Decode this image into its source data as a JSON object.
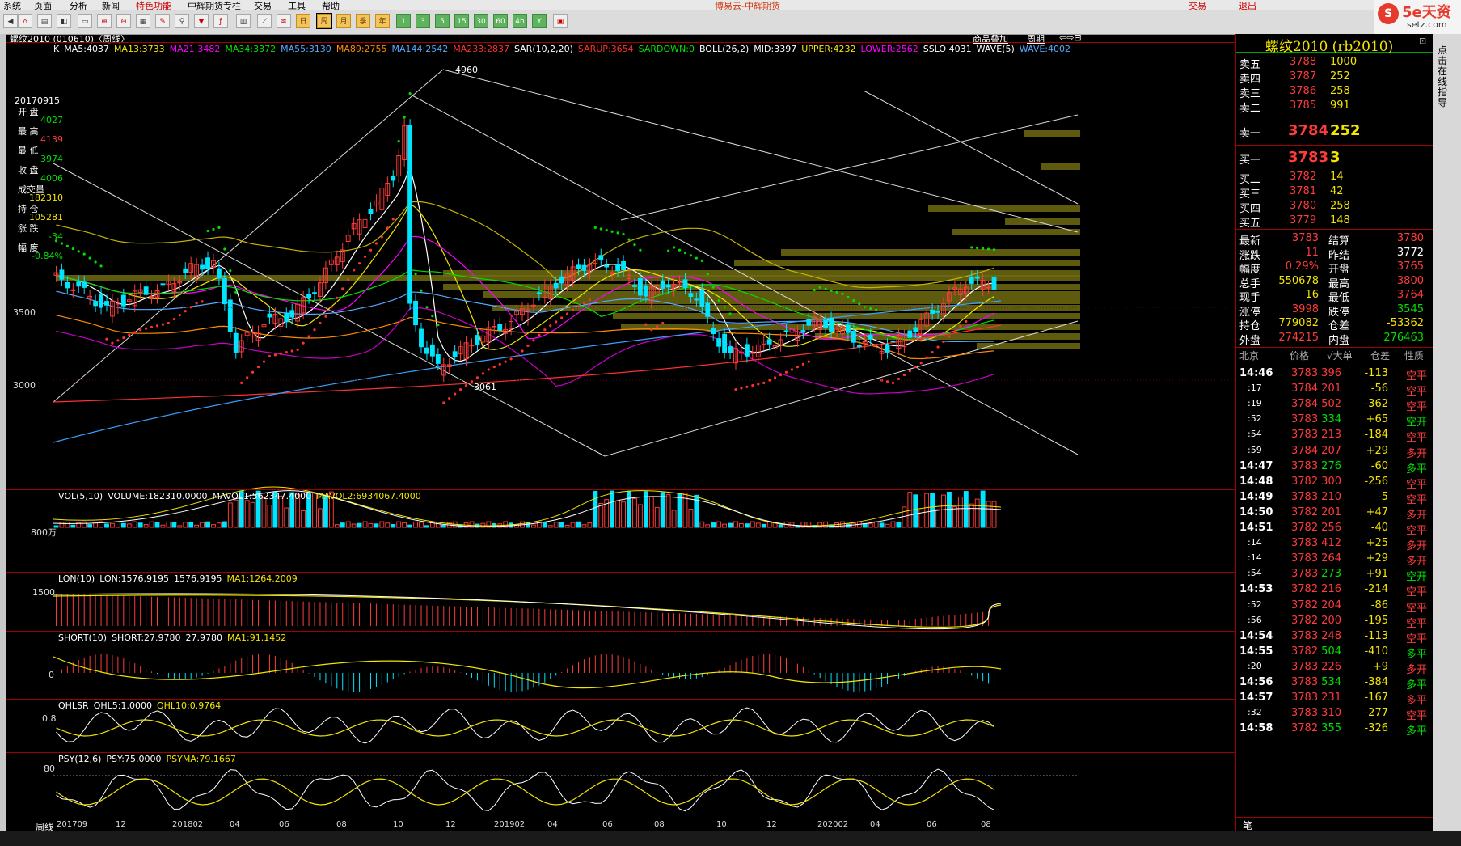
{
  "menu": {
    "items": [
      "系统",
      "页面",
      "分析",
      "新闻",
      "特色功能",
      "中辉期货专栏",
      "交易",
      "工具",
      "帮助"
    ],
    "title": "博易云-中辉期货",
    "trade_label": "交易",
    "exit_label": "退出"
  },
  "toolbar": {
    "period_buttons": [
      "日",
      "周",
      "月",
      "季",
      "年"
    ],
    "number_buttons": [
      "1",
      "3",
      "5",
      "15",
      "30",
      "60",
      "4h",
      "Y"
    ]
  },
  "chart": {
    "symbol_label": "螺纹2010 (010610)〈周线〉",
    "ma_header": [
      {
        "text": "K",
        "color": "#ffffff"
      },
      {
        "text": "MA5:4037",
        "color": "#ffffff"
      },
      {
        "text": "MA13:3733",
        "color": "#f2e500"
      },
      {
        "text": "MA21:3482",
        "color": "#ff00ff"
      },
      {
        "text": "MA34:3372",
        "color": "#00e000"
      },
      {
        "text": "MA55:3130",
        "color": "#55aaff"
      },
      {
        "text": "MA89:2755",
        "color": "#ff8c00"
      },
      {
        "text": "MA144:2542",
        "color": "#55aaff"
      },
      {
        "text": "MA233:2837",
        "color": "#ff3030"
      },
      {
        "text": "SAR(10,2,20)",
        "color": "#ffffff"
      },
      {
        "text": "SARUP:3654",
        "color": "#ff3030"
      },
      {
        "text": "SARDOWN:0",
        "color": "#00e000"
      },
      {
        "text": "BOLL(26,2)",
        "color": "#ffffff"
      },
      {
        "text": "MID:3397",
        "color": "#ffffff"
      },
      {
        "text": "UPPER:4232",
        "color": "#f2e500"
      },
      {
        "text": "LOWER:2562",
        "color": "#ff00ff"
      },
      {
        "text": "SSLO 4031",
        "color": "#ffffff"
      },
      {
        "text": "WAVE(5)",
        "color": "#ffffff"
      },
      {
        "text": "WAVE:4002",
        "color": "#55aaff"
      }
    ],
    "top_right_links": [
      "商品叠加",
      "周期"
    ],
    "price_axis": [
      "3500",
      "3000"
    ],
    "high_label": "4960",
    "low_label": "3061",
    "info_panel": {
      "date": "20170915",
      "open_label": "开 盘",
      "open": "4027",
      "high_label": "最 高",
      "high": "4139",
      "low_label": "最 低",
      "low": "3974",
      "close_label": "收 盘",
      "close": "4006",
      "vol_label": "成交量",
      "vol": "182310",
      "oi_label": "持 仓",
      "oi": "105281",
      "chg_label": "涨 跌",
      "chg": "-34",
      "pct_label": "幅 度",
      "pct": "-0.84%"
    },
    "vol_header": [
      {
        "text": "VOL(5,10)",
        "color": "#ffffff"
      },
      {
        "text": "VOLUME:182310.0000",
        "color": "#ffffff"
      },
      {
        "text": "MAVOL1:562347.4000",
        "color": "#ffffff"
      },
      {
        "text": "MAVOL2:6934067.4000",
        "color": "#f2e500"
      }
    ],
    "vol_axis": "800万",
    "lon_header": [
      {
        "text": "LON(10)",
        "color": "#ffffff"
      },
      {
        "text": "LON:1576.9195",
        "color": "#ffffff"
      },
      {
        "text": "1576.9195",
        "color": "#ffffff"
      },
      {
        "text": "MA1:1264.2009",
        "color": "#f2e500"
      }
    ],
    "lon_axis": "1500",
    "short_header": [
      {
        "text": "SHORT(10)",
        "color": "#ffffff"
      },
      {
        "text": "SHORT:27.9780",
        "color": "#ffffff"
      },
      {
        "text": "27.9780",
        "color": "#ffffff"
      },
      {
        "text": "MA1:91.1452",
        "color": "#f2e500"
      }
    ],
    "short_axis": "0",
    "qhl_header": [
      {
        "text": "QHLSR",
        "color": "#ffffff"
      },
      {
        "text": "QHL5:1.0000",
        "color": "#ffffff"
      },
      {
        "text": "QHL10:0.9764",
        "color": "#f2e500"
      }
    ],
    "qhl_axis": "0.8",
    "psy_header": [
      {
        "text": "PSY(12,6)",
        "color": "#ffffff"
      },
      {
        "text": "PSY:75.0000",
        "color": "#ffffff"
      },
      {
        "text": "PSYMA:79.1667",
        "color": "#f2e500"
      }
    ],
    "psy_axis": "80",
    "period_label": "周线",
    "x_axis": [
      "201709",
      "12",
      "201802",
      "04",
      "06",
      "08",
      "10",
      "12",
      "201902",
      "04",
      "06",
      "08",
      "10",
      "12",
      "202002",
      "04",
      "06",
      "08"
    ]
  },
  "quote": {
    "title": "螺纹2010 (rb2010)",
    "asks": [
      {
        "label": "卖五",
        "price": "3788",
        "vol": "1000"
      },
      {
        "label": "卖四",
        "price": "3787",
        "vol": "252"
      },
      {
        "label": "卖三",
        "price": "3786",
        "vol": "258"
      },
      {
        "label": "卖二",
        "price": "3785",
        "vol": "991"
      }
    ],
    "ask1": {
      "label": "卖一",
      "price": "3784",
      "vol": "252"
    },
    "bid1": {
      "label": "买一",
      "price": "3783",
      "vol": "3"
    },
    "bids": [
      {
        "label": "买二",
        "price": "3782",
        "vol": "14"
      },
      {
        "label": "买三",
        "price": "3781",
        "vol": "42"
      },
      {
        "label": "买四",
        "price": "3780",
        "vol": "258"
      },
      {
        "label": "买五",
        "price": "3779",
        "vol": "148"
      }
    ],
    "stats": [
      {
        "l1": "最新",
        "v1": "3783",
        "c1": "#ff3b3b",
        "l2": "结算",
        "v2": "3780",
        "c2": "#ff3b3b"
      },
      {
        "l1": "涨跌",
        "v1": "11",
        "c1": "#ff3b3b",
        "l2": "昨结",
        "v2": "3772",
        "c2": "#ffffff"
      },
      {
        "l1": "幅度",
        "v1": "0.29%",
        "c1": "#ff3b3b",
        "l2": "开盘",
        "v2": "3765",
        "c2": "#ff3b3b"
      },
      {
        "l1": "总手",
        "v1": "550678",
        "c1": "#f2e500",
        "l2": "最高",
        "v2": "3800",
        "c2": "#ff3b3b"
      },
      {
        "l1": "现手",
        "v1": "16",
        "c1": "#f2e500",
        "l2": "最低",
        "v2": "3764",
        "c2": "#ff3b3b"
      },
      {
        "l1": "涨停",
        "v1": "3998",
        "c1": "#ff3b3b",
        "l2": "跌停",
        "v2": "3545",
        "c2": "#00e000"
      },
      {
        "l1": "持仓",
        "v1": "779082",
        "c1": "#f2e500",
        "l2": "仓差",
        "v2": "-53362",
        "c2": "#f2e500"
      },
      {
        "l1": "外盘",
        "v1": "274215",
        "c1": "#ff3b3b",
        "l2": "内盘",
        "v2": "276463",
        "c2": "#00e000"
      }
    ],
    "ticks_header": {
      "time": "北京",
      "price": "价格",
      "vol": "√大单",
      "oi": "仓差",
      "nature": "性质"
    },
    "ticks": [
      {
        "t": "14:46",
        "p": "3783",
        "pc": "#ff3b3b",
        "v": "396",
        "vc": "#ff3b3b",
        "o": "-113",
        "n": "空平",
        "nc": "#ff3b3b"
      },
      {
        "t": ":17",
        "p": "3784",
        "pc": "#ff3b3b",
        "v": "201",
        "vc": "#ff3b3b",
        "o": "-56",
        "n": "空平",
        "nc": "#ff3b3b"
      },
      {
        "t": ":19",
        "p": "3784",
        "pc": "#ff3b3b",
        "v": "502",
        "vc": "#ff3b3b",
        "o": "-362",
        "n": "空平",
        "nc": "#ff3b3b"
      },
      {
        "t": ":52",
        "p": "3783",
        "pc": "#ff3b3b",
        "v": "334",
        "vc": "#00e000",
        "o": "+65",
        "n": "空开",
        "nc": "#00e000"
      },
      {
        "t": ":54",
        "p": "3783",
        "pc": "#ff3b3b",
        "v": "213",
        "vc": "#ff3b3b",
        "o": "-184",
        "n": "空平",
        "nc": "#ff3b3b"
      },
      {
        "t": ":59",
        "p": "3784",
        "pc": "#ff3b3b",
        "v": "207",
        "vc": "#ff3b3b",
        "o": "+29",
        "n": "多开",
        "nc": "#ff3b3b"
      },
      {
        "t": "14:47",
        "p": "3783",
        "pc": "#ff3b3b",
        "v": "276",
        "vc": "#00e000",
        "o": "-60",
        "n": "多平",
        "nc": "#00e000"
      },
      {
        "t": "14:48",
        "p": "3782",
        "pc": "#ff3b3b",
        "v": "300",
        "vc": "#ff3b3b",
        "o": "-256",
        "n": "空平",
        "nc": "#ff3b3b"
      },
      {
        "t": "14:49",
        "p": "3783",
        "pc": "#ff3b3b",
        "v": "210",
        "vc": "#ff3b3b",
        "o": "-5",
        "n": "空平",
        "nc": "#ff3b3b"
      },
      {
        "t": "14:50",
        "p": "3782",
        "pc": "#ff3b3b",
        "v": "201",
        "vc": "#ff3b3b",
        "o": "+47",
        "n": "多开",
        "nc": "#ff3b3b"
      },
      {
        "t": "14:51",
        "p": "3782",
        "pc": "#ff3b3b",
        "v": "256",
        "vc": "#ff3b3b",
        "o": "-40",
        "n": "空平",
        "nc": "#ff3b3b"
      },
      {
        "t": ":14",
        "p": "3783",
        "pc": "#ff3b3b",
        "v": "412",
        "vc": "#ff3b3b",
        "o": "+25",
        "n": "多开",
        "nc": "#ff3b3b"
      },
      {
        "t": ":14",
        "p": "3783",
        "pc": "#ff3b3b",
        "v": "264",
        "vc": "#ff3b3b",
        "o": "+29",
        "n": "多开",
        "nc": "#ff3b3b"
      },
      {
        "t": ":54",
        "p": "3783",
        "pc": "#ff3b3b",
        "v": "273",
        "vc": "#00e000",
        "o": "+91",
        "n": "空开",
        "nc": "#00e000"
      },
      {
        "t": "14:53",
        "p": "3782",
        "pc": "#ff3b3b",
        "v": "216",
        "vc": "#ff3b3b",
        "o": "-214",
        "n": "空平",
        "nc": "#ff3b3b"
      },
      {
        "t": ":52",
        "p": "3782",
        "pc": "#ff3b3b",
        "v": "204",
        "vc": "#ff3b3b",
        "o": "-86",
        "n": "空平",
        "nc": "#ff3b3b"
      },
      {
        "t": ":56",
        "p": "3782",
        "pc": "#ff3b3b",
        "v": "200",
        "vc": "#ff3b3b",
        "o": "-195",
        "n": "空平",
        "nc": "#ff3b3b"
      },
      {
        "t": "14:54",
        "p": "3783",
        "pc": "#ff3b3b",
        "v": "248",
        "vc": "#ff3b3b",
        "o": "-113",
        "n": "空平",
        "nc": "#ff3b3b"
      },
      {
        "t": "14:55",
        "p": "3782",
        "pc": "#ff3b3b",
        "v": "504",
        "vc": "#00e000",
        "o": "-410",
        "n": "多平",
        "nc": "#00e000"
      },
      {
        "t": ":20",
        "p": "3783",
        "pc": "#ff3b3b",
        "v": "226",
        "vc": "#ff3b3b",
        "o": "+9",
        "n": "多开",
        "nc": "#ff3b3b"
      },
      {
        "t": "14:56",
        "p": "3783",
        "pc": "#ff3b3b",
        "v": "534",
        "vc": "#00e000",
        "o": "-384",
        "n": "多平",
        "nc": "#00e000"
      },
      {
        "t": "14:57",
        "p": "3783",
        "pc": "#ff3b3b",
        "v": "231",
        "vc": "#ff3b3b",
        "o": "-167",
        "n": "多平",
        "nc": "#ff3b3b"
      },
      {
        "t": ":32",
        "p": "3783",
        "pc": "#ff3b3b",
        "v": "310",
        "vc": "#ff3b3b",
        "o": "-277",
        "n": "空平",
        "nc": "#ff3b3b"
      },
      {
        "t": "14:58",
        "p": "3782",
        "pc": "#ff3b3b",
        "v": "355",
        "vc": "#00e000",
        "o": "-326",
        "n": "多平",
        "nc": "#00e000"
      }
    ],
    "bottom_tab": "笔"
  },
  "brand": {
    "name": "5e天资",
    "url": "setz.com"
  },
  "side_tabs": [
    "点击",
    "在线",
    "指导"
  ],
  "colors": {
    "up": "#ff3b3b",
    "down": "#00e5ff",
    "grid": "#a00000",
    "yellow": "#f2e500"
  }
}
